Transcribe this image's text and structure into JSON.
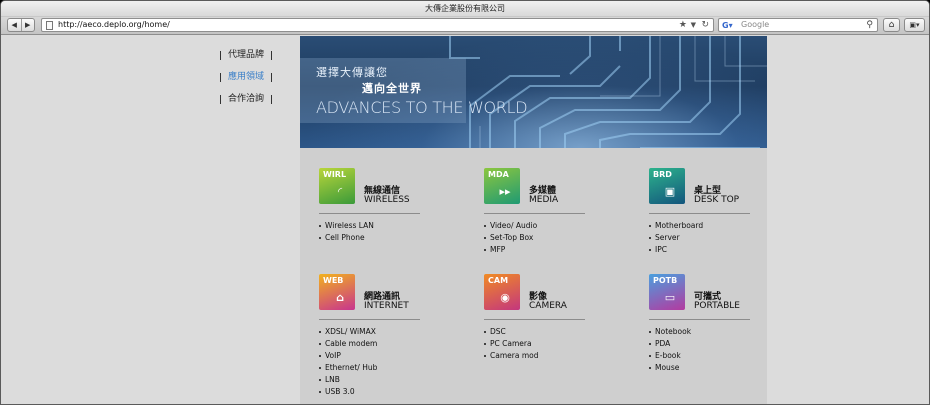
{
  "window": {
    "title": "大傳企業股份有限公司"
  },
  "browser": {
    "url": "http://aeco.deplo.org/home/",
    "search_placeholder": "Google",
    "search_engine_icon": "google-icon",
    "buttons": [
      "back",
      "forward",
      "bookmark-star",
      "reload",
      "home",
      "menu"
    ]
  },
  "sidenav": {
    "items": [
      {
        "label": "代理品牌",
        "active": false
      },
      {
        "label": "應用領域",
        "active": true
      },
      {
        "label": "合作洽詢",
        "active": false
      }
    ],
    "active_color": "#3a7fc8"
  },
  "banner": {
    "line1": "選擇大傳讓您",
    "line2": "邁向全世界",
    "line3": "ADVANCES TO THE WORLD"
  },
  "categories": [
    {
      "code": "WIRL",
      "zh": "無線通信",
      "en": "WIRELESS",
      "icon": "wifi-icon",
      "color_from": "#b9d53a",
      "color_to": "#3a9a3a",
      "items": [
        "Wireless LAN",
        "Cell Phone"
      ]
    },
    {
      "code": "MDA",
      "zh": "多媒體",
      "en": "MEDIA",
      "icon": "fast-forward-icon",
      "color_from": "#8cc63f",
      "color_to": "#1f9a73",
      "items": [
        "Video/ Audio",
        "Set-Top Box",
        "MFP"
      ]
    },
    {
      "code": "BRD",
      "zh": "桌上型",
      "en": "DESK TOP",
      "icon": "chip-icon",
      "color_from": "#2db38c",
      "color_to": "#13557d",
      "items": [
        "Motherboard",
        "Server",
        "IPC"
      ]
    },
    {
      "code": "WEB",
      "zh": "網路通訊",
      "en": "INTERNET",
      "icon": "router-icon",
      "color_from": "#f2b21d",
      "color_to": "#c8348f",
      "items": [
        "XDSL/ WiMAX",
        "Cable modem",
        "VoIP",
        "Ethernet/ Hub",
        "LNB",
        "USB 3.0"
      ]
    },
    {
      "code": "CAM",
      "zh": "影像",
      "en": "CAMERA",
      "icon": "webcam-icon",
      "color_from": "#f08b24",
      "color_to": "#c4367e",
      "items": [
        "DSC",
        "PC Camera",
        "Camera mod"
      ]
    },
    {
      "code": "POTB",
      "zh": "可攜式",
      "en": "PORTABLE",
      "icon": "laptop-icon",
      "color_from": "#4aa0de",
      "color_to": "#b43aa0",
      "items": [
        "Notebook",
        "PDA",
        "E-book",
        "Mouse"
      ]
    }
  ]
}
